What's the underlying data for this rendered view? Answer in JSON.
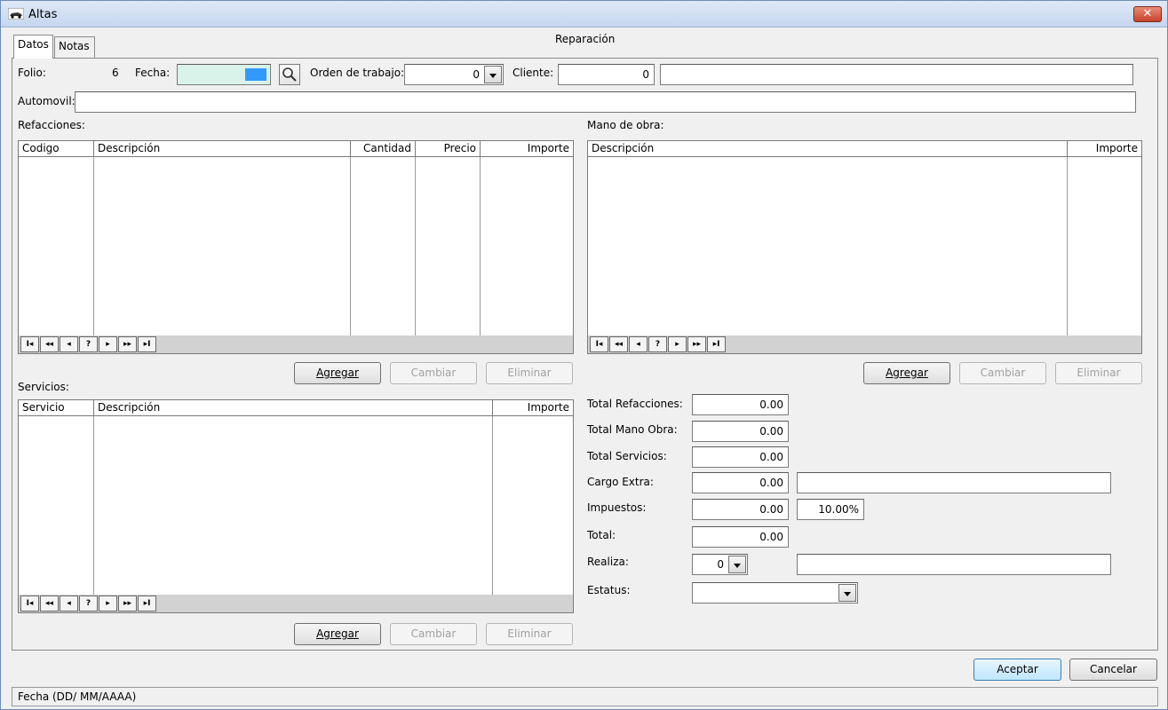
{
  "window": {
    "title": "Altas",
    "close_label": "✕"
  },
  "tabs": [
    {
      "label": "Datos"
    },
    {
      "label": "Notas"
    }
  ],
  "section_title": "Reparación",
  "header": {
    "folio_label": "Folio:",
    "folio_value": "6",
    "fecha_label": "Fecha:",
    "fecha_value": "",
    "orden_label": "Orden de trabajo:",
    "orden_value": "0",
    "cliente_label": "Cliente:",
    "cliente_id": "0",
    "cliente_name": "",
    "automovil_label": "Automovil:",
    "automovil_value": ""
  },
  "refacciones": {
    "label": "Refacciones:",
    "columns": [
      "Codigo",
      "Descripción",
      "Cantidad",
      "Precio",
      "Importe"
    ],
    "buttons": {
      "add": "Agregar",
      "change": "Cambiar",
      "delete": "Eliminar"
    }
  },
  "mano_obra": {
    "label": "Mano de obra:",
    "columns": [
      "Descripción",
      "Importe"
    ],
    "buttons": {
      "add": "Agregar",
      "change": "Cambiar",
      "delete": "Eliminar"
    }
  },
  "servicios": {
    "label": "Servicios:",
    "columns": [
      "Servicio",
      "Descripción",
      "Importe"
    ],
    "buttons": {
      "add": "Agregar",
      "change": "Cambiar",
      "delete": "Eliminar"
    }
  },
  "nav_buttons": [
    "I◂",
    "◂◂",
    "◂",
    "?",
    "▸",
    "▸▸",
    "▸I"
  ],
  "totals": {
    "total_refacciones_label": "Total Refacciones:",
    "total_refacciones": "0.00",
    "total_mano_obra_label": "Total Mano Obra:",
    "total_mano_obra": "0.00",
    "total_servicios_label": "Total Servicios:",
    "total_servicios": "0.00",
    "cargo_extra_label": "Cargo Extra:",
    "cargo_extra": "0.00",
    "cargo_extra_desc": "",
    "impuestos_label": "Impuestos:",
    "impuestos": "0.00",
    "impuestos_pct": "10.00%",
    "total_label": "Total:",
    "total": "0.00",
    "realiza_label": "Realiza:",
    "realiza_value": "0",
    "realiza_name": "",
    "estatus_label": "Estatus:",
    "estatus_value": ""
  },
  "footer": {
    "accept": "Aceptar",
    "cancel": "Cancelar"
  },
  "status_text": "Fecha (DD/ MM/AAAA)",
  "colors": {
    "date_field": "#d9f2ea",
    "date_marker": "#3399ff"
  }
}
